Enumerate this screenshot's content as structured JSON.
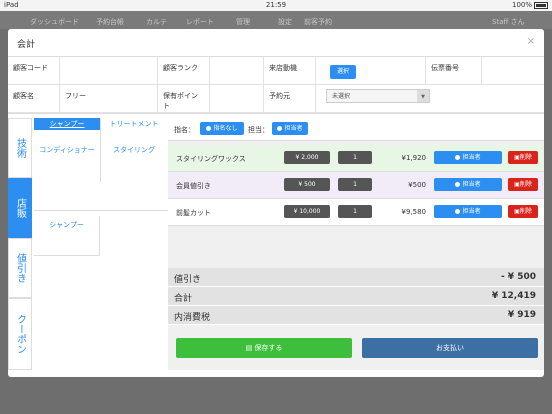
{
  "status": {
    "carrier": "iPad",
    "time": "21:59",
    "battery": "100%"
  },
  "bg_nav": [
    "ダッシュボード",
    "予約台帳",
    "カルテ",
    "レポート",
    "管理",
    "設定",
    "前客予約",
    "Staff さん"
  ],
  "modal": {
    "title": "会計",
    "close": "×",
    "info": {
      "customer_code_label": "顧客コード",
      "customer_rank_label": "顧客ランク",
      "visit_motive_label": "来店動機",
      "select_label": "選択",
      "slip_no_label": "伝票番号",
      "customer_name_label": "顧客名",
      "customer_name_value": "フリー",
      "points_label": "保有ポイント",
      "booking_src_label": "予約元",
      "booking_src_value": "未選択"
    },
    "side_tabs": [
      "技術",
      "店販",
      "値引き",
      "クーポン"
    ],
    "categories": [
      "シャンプー",
      "トリートメント",
      "コンディショナー",
      "スタイリング"
    ],
    "products": [
      "シャンプー"
    ],
    "assign": {
      "designate_label": "指名：",
      "no_designate": "指名なし",
      "staff_label": "担当：",
      "staff_btn": "担当者"
    },
    "rows": [
      {
        "name": "スタイリングワックス",
        "price": "¥ 2,000",
        "qty": "1",
        "amount": "¥1,920",
        "staff": "担当者",
        "delete": "削除"
      },
      {
        "name": "会員値引き",
        "price": "¥ 500",
        "qty": "1",
        "amount": "¥500",
        "staff": "担当者",
        "delete": "削除"
      },
      {
        "name": "前髪カット",
        "price": "¥ 10,000",
        "qty": "1",
        "amount": "¥9,580",
        "staff": "担当者",
        "delete": "削除"
      }
    ],
    "summary": [
      {
        "label": "値引き",
        "value": "- ¥ 500"
      },
      {
        "label": "合計",
        "value": "¥ 12,419"
      },
      {
        "label": "内消費税",
        "value": "¥ 919"
      }
    ],
    "save_label": "保存する",
    "pay_label": "お支払い"
  },
  "colors": {
    "accent": "#2b8ef0",
    "danger": "#d9241c",
    "save": "#3dbf3d",
    "pay": "#3c6fa4"
  }
}
